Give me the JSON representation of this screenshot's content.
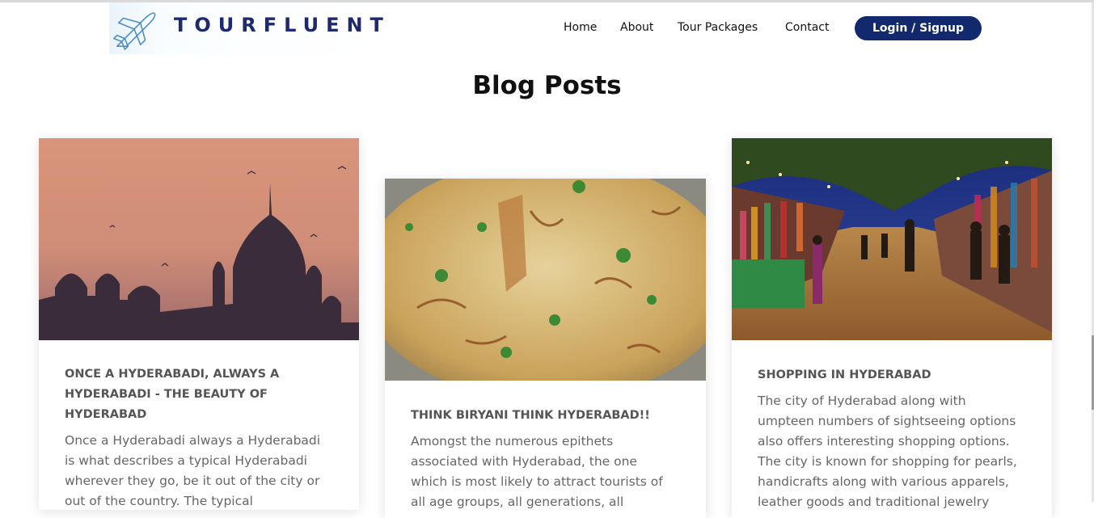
{
  "header": {
    "brand": "TOURFLUENT",
    "logo_icon": "airplane-icon",
    "nav": {
      "home": "Home",
      "about": "About",
      "packages": "Tour Packages",
      "contact": "Contact"
    },
    "login_label": "Login / Signup",
    "accent_color": "#12296e"
  },
  "page_title": "Blog Posts",
  "posts": [
    {
      "title_line1": "ONCE A HYDERABADI, ALWAYS A",
      "title_line2": "HYDERABADI - THE BEAUTY OF",
      "title_line3": "HYDERABAD",
      "text_line1": "Once a Hyderabadi always a Hyderabadi",
      "text_line2": "is what describes a typical Hyderabadi",
      "text_line3": "wherever they go, be it out of the city or",
      "text_line4": "out of the country. The typical"
    },
    {
      "title_line1": "THINK BIRYANI THINK HYDERABAD!!",
      "text_line1": "Amongst the numerous epithets",
      "text_line2": "associated with Hyderabad, the one",
      "text_line3": "which is most likely to attract tourists of",
      "text_line4": "all age groups, all generations, all"
    },
    {
      "title_line1": "SHOPPING IN HYDERABAD",
      "text_line1": "The city of Hyderabad along with",
      "text_line2": "umpteen numbers of sightseeing options",
      "text_line3": "also offers interesting shopping options.",
      "text_line4": "The city is known for shopping for pearls,",
      "text_line5": "handicrafts along with various apparels,",
      "text_line6": "leather goods and traditional jewelry"
    }
  ]
}
